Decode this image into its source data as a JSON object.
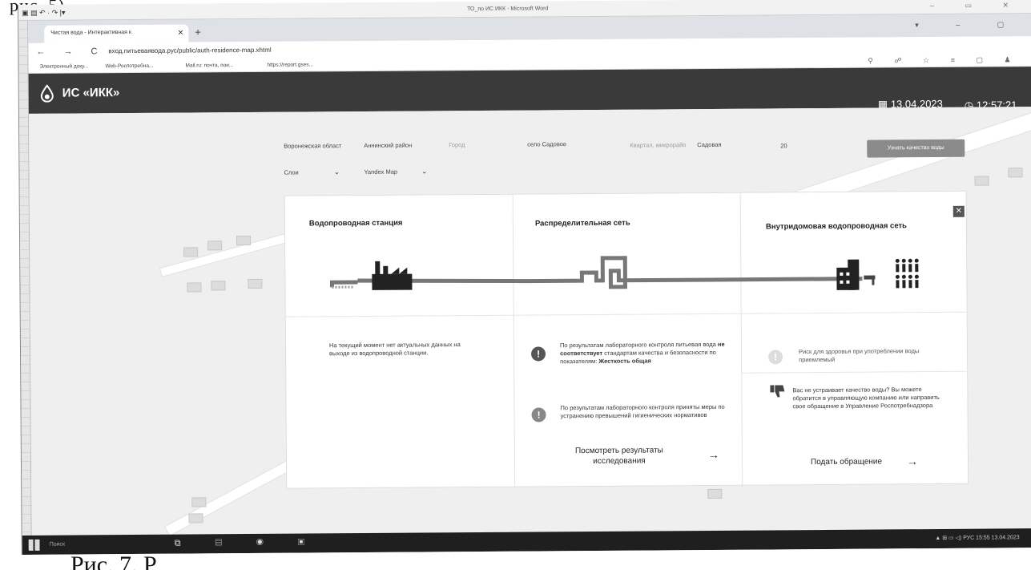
{
  "page_caption": "рис. 5).",
  "bottom_caption": "Рис. 7. Р",
  "word": {
    "qat": "▣ ▤ ↶ · ↷ |▾",
    "title": "ТО_по ИС ИКК - Microsoft Word",
    "controls": "–  ▭  ✕"
  },
  "browser": {
    "tab_title": "Чистая вода - Интерактивная к",
    "tab_close": "✕",
    "new_tab": "+",
    "tab_controls": "▾  –  ▢",
    "nav": "← → C",
    "url": "вход.питьеваявода.рус/public/auth-residence-map.xhtml",
    "bookmarks": [
      "Электронный доку...",
      "Web-Роспотребна...",
      "Mail.ru: почта, пои...",
      "https://report.gses..."
    ],
    "right_tools": "⚲ ☍ ☆ ≡ ▢ ♟"
  },
  "app": {
    "title": "ИС «ИКК»",
    "date": "13.04.2023",
    "time": "12:57:21"
  },
  "filters": {
    "region": "Воронежская област",
    "district": "Аннинский район",
    "city_placeholder": "Город",
    "settlement": "село Садовое",
    "district2_placeholder": "Квартал, микрорайо",
    "street": "Садовая",
    "house": "20",
    "check_button": "Узнать качество воды",
    "layers_label": "Слои",
    "map_provider": "Yandex Map"
  },
  "columns": [
    {
      "title": "Водопроводная станция"
    },
    {
      "title": "Распределительная сеть"
    },
    {
      "title": "Внутридомовая водопроводная сеть"
    }
  ],
  "station_msg": "На текущий момент нет актуальных данных на выходе из водопроводной станции.",
  "network": {
    "msg1_prefix": "По результатам лабораторного контроля питьевая вода ",
    "msg1_bold": "не соответствует",
    "msg1_mid": " стандартам качества и безопасности по показателям: ",
    "msg1_param": "Жесткость общая",
    "msg2": "По результатам лабораторного контроля приняты меры по устранению превышений гигиенических нормативов",
    "link": "Посмотреть результаты исследования",
    "link_arrow": "→"
  },
  "house": {
    "risk_msg": "Риск для здоровья при употреблении воды приемлемый",
    "complaint_msg": "Вас не устраивает качество воды? Вы можете обратится в управляющую компанию или направить свое обращение в Управление Роспотребнадзора",
    "complaint_link": "Подать обращение",
    "complaint_arrow": "→"
  },
  "taskbar": {
    "search": "Поиск",
    "tray": "▲ ⊞ ▭ ◁) РУС  15:55\n13.04.2023"
  },
  "colors": {
    "header_bg": "#3a3a3a",
    "pipe": "#777777",
    "warn": "#555555",
    "info": "#888888"
  }
}
